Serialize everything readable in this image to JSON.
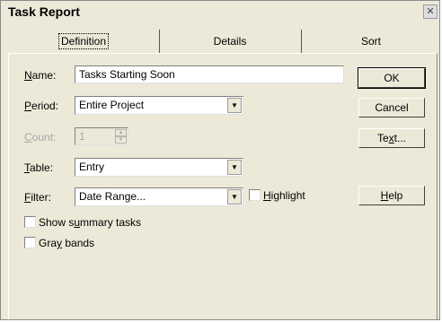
{
  "dialog": {
    "title": "Task Report"
  },
  "tabs": [
    {
      "label": "Definition",
      "active": true
    },
    {
      "label": "Details",
      "active": false
    },
    {
      "label": "Sort",
      "active": false
    }
  ],
  "form": {
    "name": {
      "label_pre": "",
      "label_key": "N",
      "label_post": "ame:",
      "value": "Tasks Starting Soon"
    },
    "period": {
      "label_pre": "",
      "label_key": "P",
      "label_post": "eriod:",
      "value": "Entire Project"
    },
    "count": {
      "label_pre": "",
      "label_key": "C",
      "label_post": "ount:",
      "value": "1"
    },
    "table": {
      "label_pre": "",
      "label_key": "T",
      "label_post": "able:",
      "value": "Entry"
    },
    "filter": {
      "label_pre": "",
      "label_key": "F",
      "label_post": "ilter:",
      "value": "Date Range..."
    },
    "highlight": {
      "label_pre": "",
      "label_key": "H",
      "label_post": "ighlight",
      "checked": false
    },
    "show_summary": {
      "label_pre": "Show s",
      "label_key": "u",
      "label_post": "mmary tasks",
      "checked": false
    },
    "gray_bands": {
      "label_pre": "Gra",
      "label_key": "y",
      "label_post": " bands",
      "checked": false
    }
  },
  "buttons": {
    "ok": "OK",
    "cancel": "Cancel",
    "text": {
      "pre": "Te",
      "key": "x",
      "post": "t..."
    },
    "help": {
      "pre": "",
      "key": "H",
      "post": "elp"
    }
  },
  "icons": {
    "close": "close-icon",
    "dropdown": "dropdown-arrow-icon",
    "spin": "spinner-arrows-icon",
    "checkbox": "checkbox-icon"
  }
}
